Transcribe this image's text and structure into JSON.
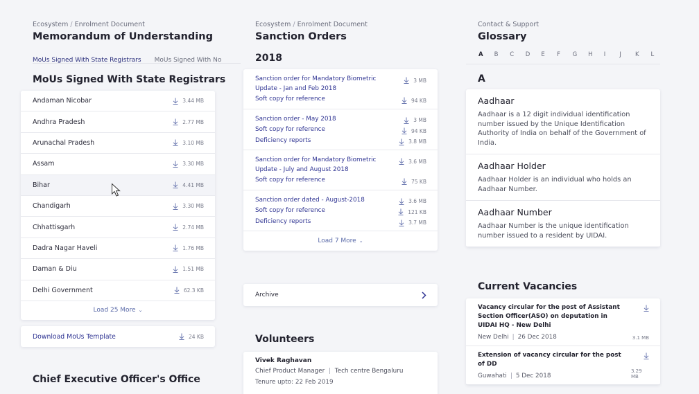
{
  "mou": {
    "breadcrumb": {
      "root": "Ecosystem",
      "sep": "/",
      "current": "Enrolment Document"
    },
    "title": "Memorandum of Understanding",
    "tabs": [
      {
        "label": "MoUs Signed With State Registrars",
        "active": true
      },
      {
        "label": "MoUs Signed With No",
        "active": false
      }
    ],
    "section_title": "MoUs Signed With State Registrars",
    "states": [
      {
        "name": "Andaman Nicobar",
        "size": "3.44 MB"
      },
      {
        "name": "Andhra Pradesh",
        "size": "2.77 MB"
      },
      {
        "name": "Arunachal Pradesh",
        "size": "3.10 MB"
      },
      {
        "name": "Assam",
        "size": "3.30 MB"
      },
      {
        "name": "Bihar",
        "size": "4.41 MB"
      },
      {
        "name": "Chandigarh",
        "size": "3.30 MB"
      },
      {
        "name": "Chhattisgarh",
        "size": "2.74 MB"
      },
      {
        "name": "Dadra Nagar Haveli",
        "size": "1.76 MB"
      },
      {
        "name": "Daman & Diu",
        "size": "1.51 MB"
      },
      {
        "name": "Delhi Government",
        "size": "62.3 KB"
      }
    ],
    "load_more": "Load 25 More",
    "template": {
      "label": "Download MoUs Template",
      "size": "24 KB"
    },
    "next_section": "Chief Executive Officer's Office"
  },
  "sanction": {
    "breadcrumb": {
      "root": "Ecosystem",
      "sep": "/",
      "current": "Enrolment Document"
    },
    "title": "Sanction Orders",
    "year": "2018",
    "groups": [
      {
        "items": [
          {
            "label": "Sanction order for Mandatory Biometric Update - Jan and Feb 2018",
            "size": "3 MB"
          },
          {
            "label": "Soft copy for reference",
            "size": "94 KB"
          }
        ]
      },
      {
        "items": [
          {
            "label": "Sanction order - May 2018",
            "size": "3 MB"
          },
          {
            "label": "Soft copy for reference",
            "size": "94 KB"
          },
          {
            "label": "Deficiency reports",
            "size": "3.8 MB"
          }
        ]
      },
      {
        "items": [
          {
            "label": "Sanction order for Mandatory Biometric Update - July and August 2018",
            "size": "3.6 MB"
          },
          {
            "label": "Soft copy for reference",
            "size": "75 KB"
          }
        ]
      },
      {
        "items": [
          {
            "label": "Sanction order dated - August-2018",
            "size": "3.6 MB"
          },
          {
            "label": "Soft copy for reference",
            "size": "121 KB"
          },
          {
            "label": "Deficiency reports",
            "size": "3.7 MB"
          }
        ]
      }
    ],
    "load_more": "Load 7 More",
    "archive": "Archive"
  },
  "volunteers": {
    "title": "Volunteers",
    "name": "Vivek Raghavan",
    "role": "Chief Product Manager",
    "role_sep": "|",
    "location": "Tech centre Bengaluru",
    "tenure": "Tenure upto: 22 Feb 2019"
  },
  "glossary": {
    "breadcrumb": "Contact & Support",
    "title": "Glossary",
    "letters": [
      "A",
      "B",
      "C",
      "D",
      "E",
      "F",
      "G",
      "H",
      "I",
      "J",
      "K",
      "L"
    ],
    "active_letter": "A",
    "section_letter": "A",
    "terms": [
      {
        "term": "Aadhaar",
        "def": "Aadhaar is a 12 digit individual identification number issued by the Unique Identification Authority of India on behalf of the Government of India."
      },
      {
        "term": "Aadhaar Holder",
        "def": "Aadhaar Holder is an individual who holds an Aadhaar Number."
      },
      {
        "term": "Aadhaar Number",
        "def": "Aadhaar Number is the unique identification number issued to a resident by UIDAI."
      }
    ]
  },
  "vacancies": {
    "title": "Current Vacancies",
    "items": [
      {
        "title": "Vacancy circular for the post of Assistant Section Officer(ASO) on deputation in UIDAI HQ - New Delhi",
        "location": "New Delhi",
        "sep": "|",
        "date": "26 Dec 2018",
        "size": "3.1 MB"
      },
      {
        "title": "Extension of vacancy circular for the post of DD",
        "location": "Guwahati",
        "sep": "|",
        "date": "5 Dec 2018",
        "size": "3.29 MB"
      }
    ]
  },
  "colors": {
    "link": "#2e3392",
    "accent": "#2b2f7c",
    "background": "#f4f5f8"
  }
}
